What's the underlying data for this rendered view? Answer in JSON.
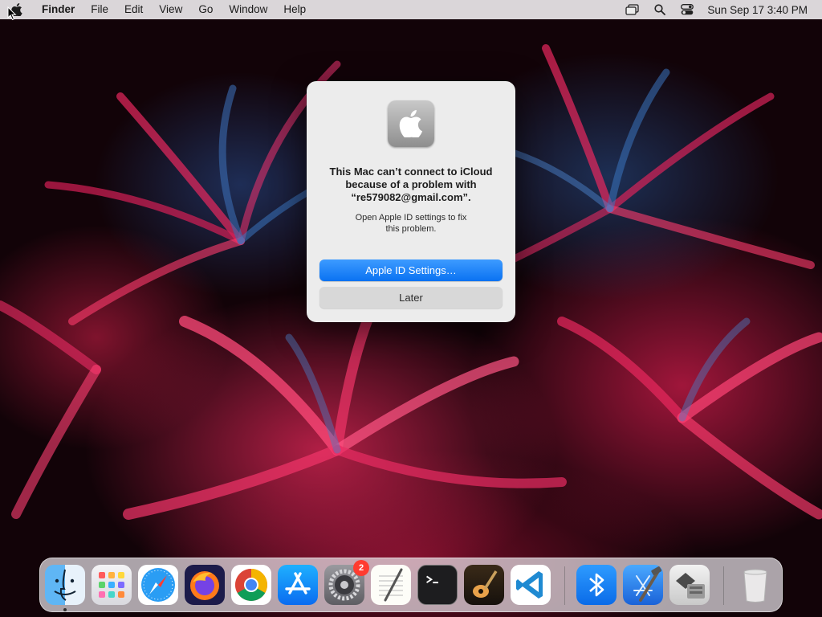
{
  "menubar": {
    "app_name": "Finder",
    "items": [
      "File",
      "Edit",
      "View",
      "Go",
      "Window",
      "Help"
    ],
    "status_icons": [
      "screen-mirroring-icon",
      "spotlight-search-icon",
      "control-center-icon"
    ],
    "clock": "Sun Sep 17  3:40 PM"
  },
  "dialog": {
    "icon": "apple-logo-icon",
    "title_lines": [
      "This Mac can’t connect to iCloud",
      "because of a problem with",
      "“re579082@gmail.com”."
    ],
    "message_lines": [
      "Open Apple ID settings to fix",
      "this problem."
    ],
    "primary_button": "Apple ID Settings…",
    "secondary_button": "Later"
  },
  "dock": {
    "apps": [
      {
        "name": "finder-icon",
        "running": true
      },
      {
        "name": "launchpad-icon"
      },
      {
        "name": "safari-icon"
      },
      {
        "name": "firefox-icon"
      },
      {
        "name": "chrome-icon"
      },
      {
        "name": "app-store-icon"
      },
      {
        "name": "system-settings-icon",
        "badge": "2"
      },
      {
        "name": "textedit-icon"
      },
      {
        "name": "terminal-icon"
      },
      {
        "name": "garageband-icon"
      },
      {
        "name": "vscode-icon"
      },
      {
        "name": "bluetooth-file-exchange-icon"
      },
      {
        "name": "xcode-icon"
      },
      {
        "name": "boot-camp-assistant-icon"
      },
      {
        "name": "trash-icon"
      }
    ]
  },
  "colors": {
    "primary_button": "#0a72f2",
    "badge": "#ff3b30"
  }
}
